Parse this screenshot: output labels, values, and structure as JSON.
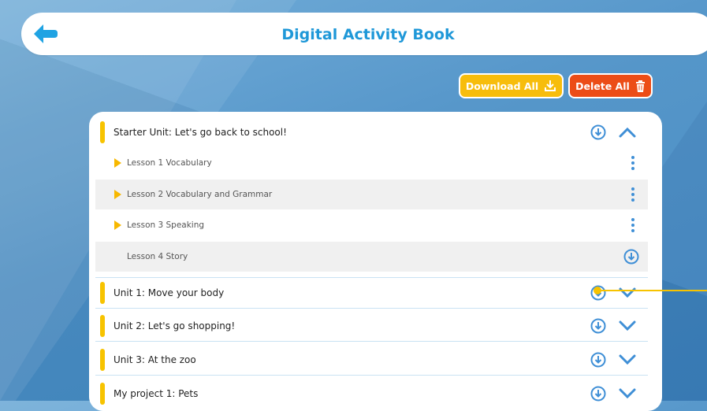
{
  "header": {
    "title": "Digital Activity Book",
    "back_icon": "back-arrow-icon"
  },
  "toolbar": {
    "download_all_label": "Download All",
    "delete_all_label": "Delete All",
    "download_color": "#f7bd0c",
    "delete_color": "#ec4d17"
  },
  "units": [
    {
      "label": "Starter Unit: Let's go back to school!",
      "expanded": true,
      "lessons": [
        {
          "label": "Lesson 1 Vocabulary",
          "action": "more"
        },
        {
          "label": "Lesson 2 Vocabulary and Grammar",
          "action": "more"
        },
        {
          "label": "Lesson 3 Speaking",
          "action": "more"
        },
        {
          "label": "Lesson 4 Story",
          "action": "download"
        }
      ]
    },
    {
      "label": "Unit 1: Move your body",
      "expanded": false
    },
    {
      "label": "Unit 2: Let's go shopping!",
      "expanded": false
    },
    {
      "label": "Unit 3: At the zoo",
      "expanded": false
    },
    {
      "label": "My project 1: Pets",
      "expanded": false
    }
  ],
  "colors": {
    "accent": "#f7c300",
    "title": "#1f98d8",
    "icon": "#3f8fd6"
  }
}
